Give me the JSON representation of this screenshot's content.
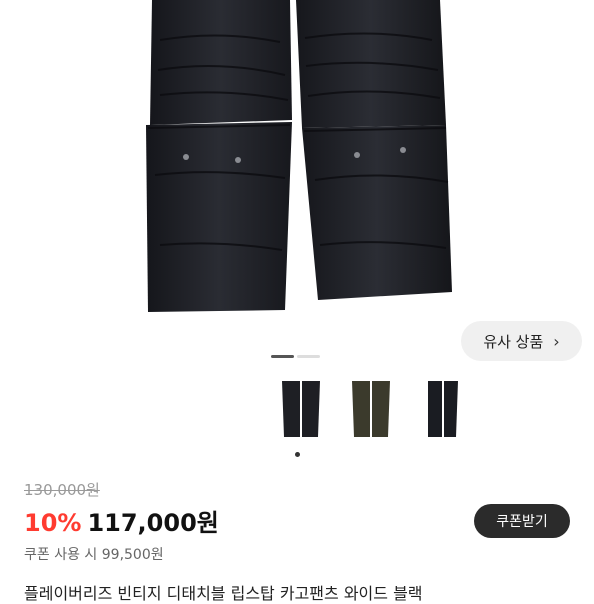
{
  "product": {
    "similar_button_label": "유사 상품",
    "similar_button_chevron": "›",
    "original_price": "130,000원",
    "discount_rate": "10%",
    "sale_price": "117,000원",
    "coupon_button_label": "쿠폰받기",
    "coupon_price_text": "쿠폰 사용 시 99,500원",
    "title_partial": "플레이버리즈 빈티지 디태치블 립스탑 카고팬츠 와이드 블랙"
  },
  "gallery": {
    "image_count": 2,
    "active_index": 0,
    "thumbnails": [
      {
        "label": "black",
        "color": "#1e1f24"
      },
      {
        "label": "olive",
        "color": "#3b3a2c"
      },
      {
        "label": "navy",
        "color": "#1a1c22"
      }
    ]
  },
  "colors": {
    "discount": "#ff3b30",
    "pants": "#1f2026"
  }
}
